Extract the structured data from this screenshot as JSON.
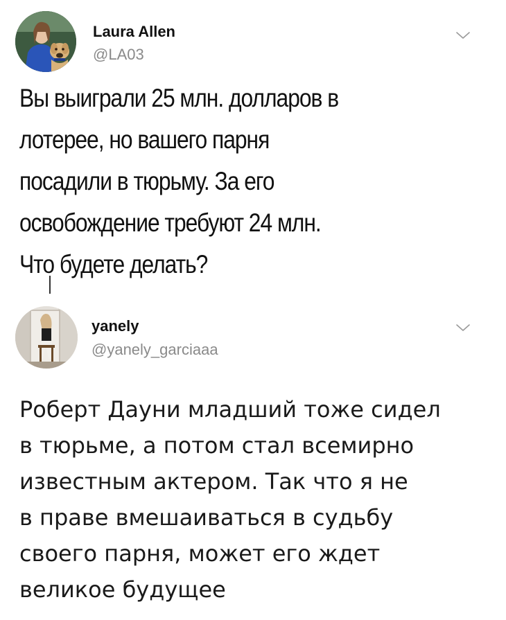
{
  "tweets": [
    {
      "name": "Laura Allen",
      "handle": "@LA03",
      "text": "Вы выиграли 25 млн. долларов в\nлотерее, но вашего парня\nпосадили в тюрьму. За его\nосвобождение требуют 24 млн.\nЧто будете делать?"
    },
    {
      "name": "yanely",
      "handle": "@yanely_garciaaa",
      "text": "Роберт Дауни младший тоже сидел\nв тюрьме, а потом стал всемирно\nизвестным актером. Так что я не\nв праве вмешаиваться в судьбу\nсвоего парня, может его ждет\nвеликое будущее"
    }
  ],
  "icons": {
    "menu_chevron": "chevron-down-icon",
    "chevron_color": "#9a9a9a"
  }
}
